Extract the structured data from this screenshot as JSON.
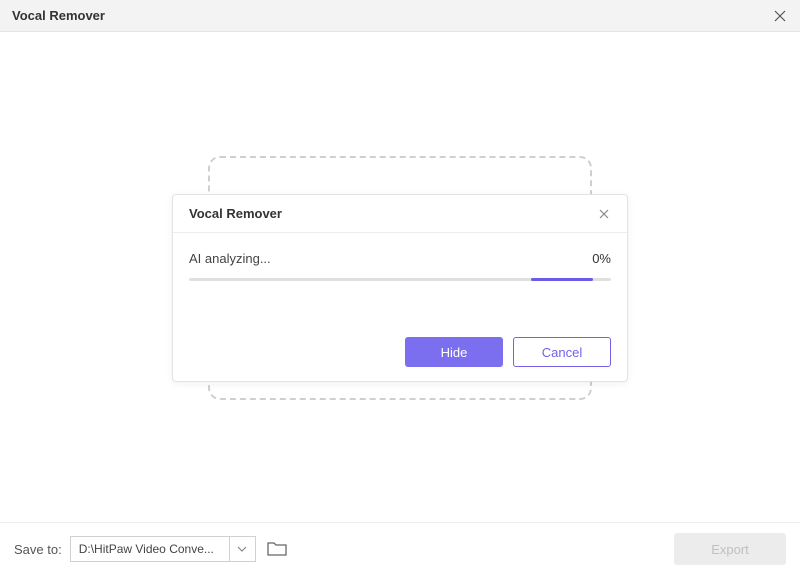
{
  "header": {
    "title": "Vocal Remover"
  },
  "modal": {
    "title": "Vocal Remover",
    "status": "AI analyzing...",
    "percent": "0%",
    "hide_label": "Hide",
    "cancel_label": "Cancel"
  },
  "footer": {
    "save_label": "Save to:",
    "path": "D:\\HitPaw Video Conve...",
    "export_label": "Export"
  },
  "colors": {
    "accent": "#7b6ff0"
  }
}
